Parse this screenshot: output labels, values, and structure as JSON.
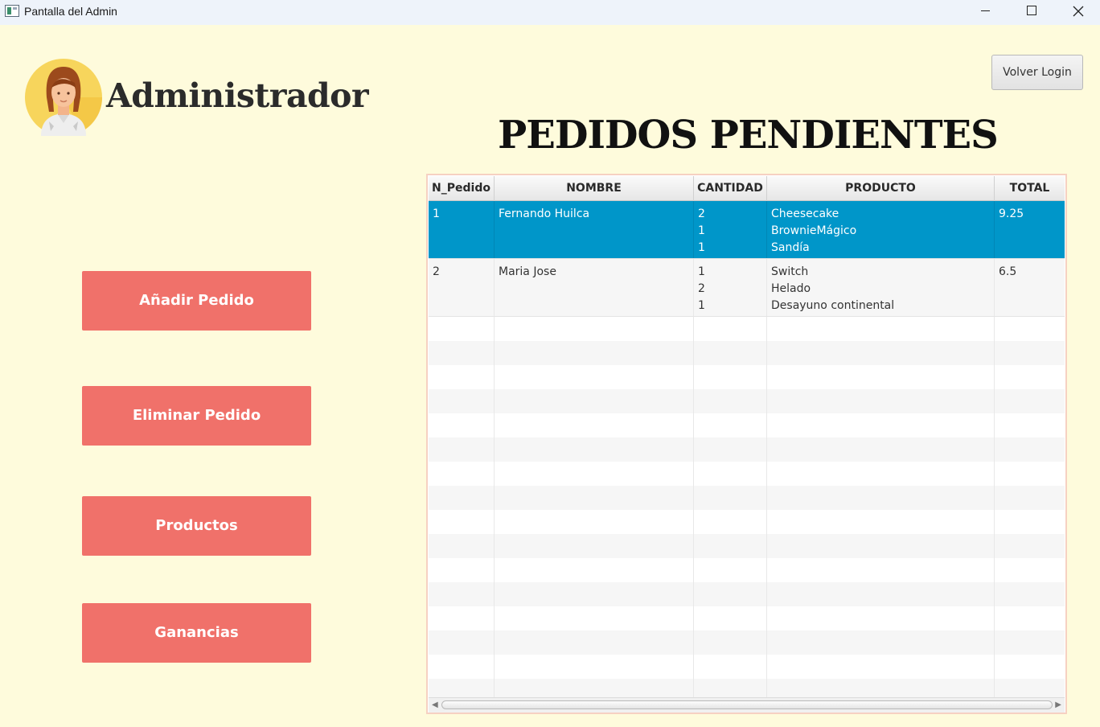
{
  "window": {
    "title": "Pantalla del Admin"
  },
  "header": {
    "admin_title": "Administrador",
    "login_button": "Volver Login",
    "main_title": "PEDIDOS PENDIENTES"
  },
  "sidebar": {
    "buttons": [
      "Añadir Pedido",
      "Eliminar Pedido",
      "Productos",
      "Ganancias"
    ]
  },
  "table": {
    "columns": [
      "N_Pedido",
      "NOMBRE",
      "CANTIDAD",
      "PRODUCTO",
      "TOTAL"
    ],
    "rows": [
      {
        "n_pedido": "1",
        "nombre": "Fernando Huilca",
        "cantidad": "2\n1\n1",
        "producto": "Cheesecake\nBrownieMágico\nSandía",
        "total": "9.25",
        "selected": true
      },
      {
        "n_pedido": "2",
        "nombre": "Maria Jose",
        "cantidad": "1\n2\n1",
        "producto": "Switch\nHelado\nDesayuno continental",
        "total": "6.5",
        "selected": false
      }
    ]
  },
  "colors": {
    "background": "#fefbdc",
    "accent_button": "#f0716a",
    "selection": "#0096c9"
  },
  "icons": {
    "avatar": "user-avatar-icon",
    "close": "close-icon",
    "minimize": "minimize-icon",
    "maximize": "maximize-icon"
  }
}
